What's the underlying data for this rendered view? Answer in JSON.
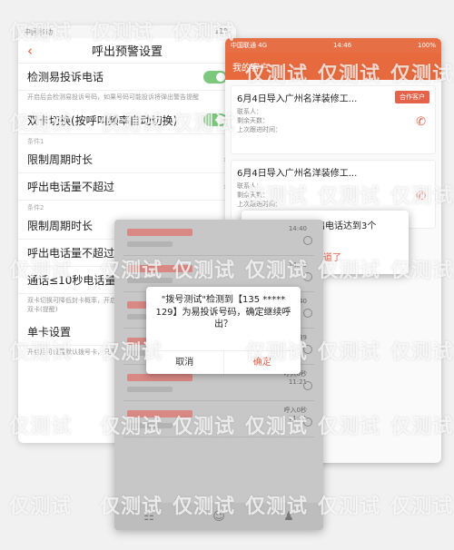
{
  "settings_screen": {
    "status_left": "中国移动",
    "status_right": "11%",
    "title": "呼出预警设置",
    "rows": [
      {
        "label": "检测易投诉电话",
        "note": "开启后会检测易投诉号码，如果号码可能投诉将弹出警告提醒"
      },
      {
        "label": "双卡切换(按呼叫频率自动切换)",
        "note": ""
      },
      {
        "label": "限制周期时长",
        "note": "",
        "cond": "条件1"
      },
      {
        "label": "呼出电话量不超过",
        "note": ""
      },
      {
        "label": "限制周期时长",
        "note": "",
        "cond": "条件2"
      },
      {
        "label": "呼出电话量不超过",
        "note": ""
      },
      {
        "label": "通话≤10秒电话量",
        "note": "双卡切换可降低封卡概率，开启后自动切换手机卡拨打，请确认手机有双卡(提醒)"
      },
      {
        "label": "单卡设置",
        "note": "开启后可设置默认拨号卡，只用一张卡拨打(需满足条件即可)"
      }
    ]
  },
  "list_screen": {
    "status_left": "中国联通 4G",
    "status_time": "14:46",
    "status_right": "100%",
    "header": "我的客户",
    "cards": [
      {
        "title": "6月4日导入广州名洋装修工...",
        "badge": "合作客户",
        "meta": [
          "联系人：",
          "剩余天数：",
          "上次跟进时间："
        ]
      },
      {
        "title": "6月4日导入广州名洋装修工...",
        "badge": "",
        "meta": [
          "联系人：",
          "剩余天数：",
          "上次跟进时间："
        ]
      }
    ],
    "popup_message": "5分钟内呼出电话达到3个",
    "popup_button": "知道了"
  },
  "dialog_screen": {
    "list_times": [
      "14:40",
      "14:40",
      "14:40",
      "14:39",
      "11:21",
      "11:21"
    ],
    "list_labels": [
      "呼入0秒",
      "呼入0秒"
    ],
    "dialog_message": "\"拨号测试\"检测到【135 ***** 129】为易投诉号码，确定继续呼出？",
    "cancel_label": "取消",
    "confirm_label": "确定"
  },
  "watermark_text": "仅测试"
}
